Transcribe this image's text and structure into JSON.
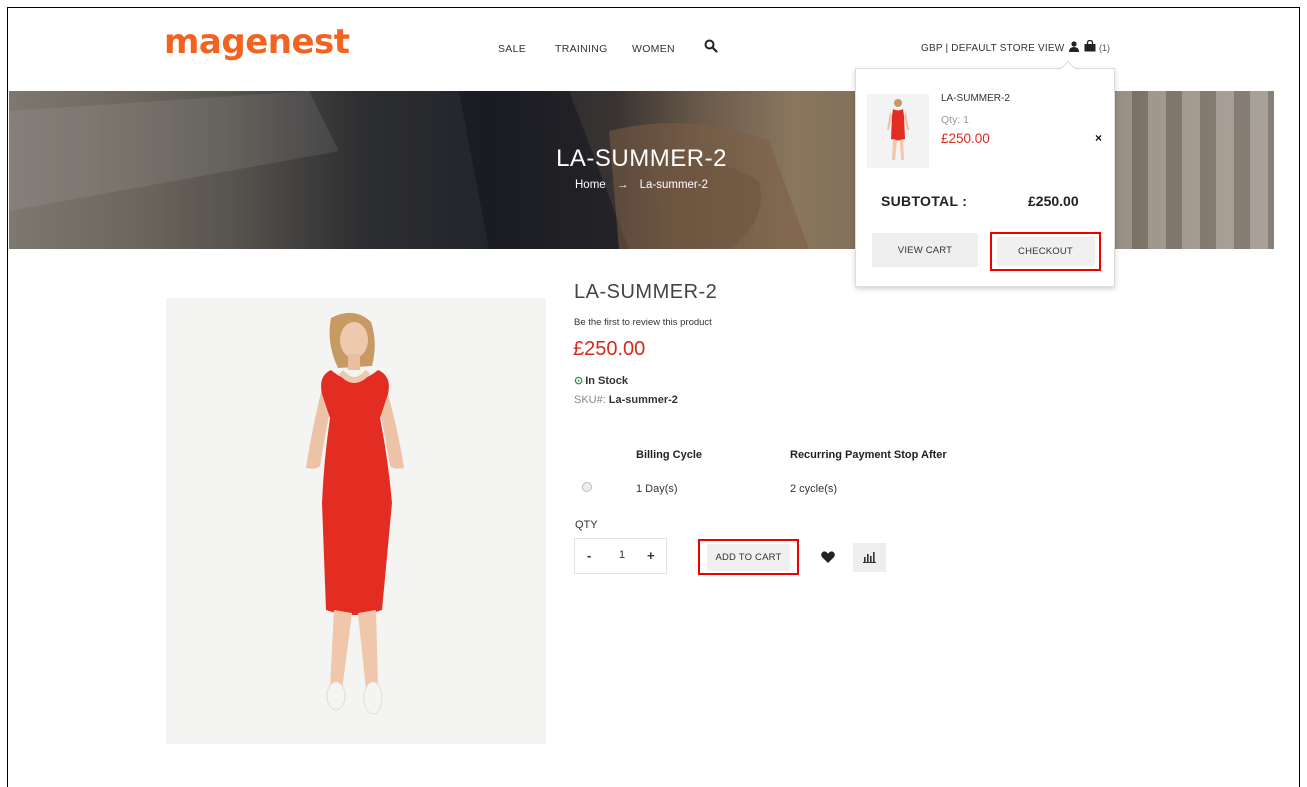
{
  "header": {
    "logo_part1": "mage",
    "logo_part2": "nest",
    "logo_color1": "#f26322",
    "logo_color2": "#f26322",
    "nav": [
      {
        "label": "SALE"
      },
      {
        "label": "TRAINING"
      },
      {
        "label": "WOMEN"
      }
    ],
    "store_label": "GBP | DEFAULT STORE VIEW",
    "cart_count": "(1)",
    "icons": [
      "search-icon",
      "user-icon",
      "cart-icon"
    ]
  },
  "banner": {
    "title": "LA-SUMMER-2",
    "breadcrumb_home": "Home",
    "breadcrumb_arrow": "→",
    "breadcrumb_current": "La-summer-2"
  },
  "product": {
    "title": "LA-SUMMER-2",
    "review_text": "Be the first to review this product",
    "price": "£250.00",
    "stock": "In Stock",
    "sku_label": "SKU#:",
    "sku_value": "La-summer-2",
    "billing_header": "Billing Cycle",
    "recurring_header": "Recurring Payment Stop After",
    "billing_value": "1 Day(s)",
    "recurring_value": "2 cycle(s)",
    "qty_label": "QTY",
    "qty_minus": "-",
    "qty_value": "1",
    "qty_plus": "+",
    "add_to_cart": "ADD TO CART",
    "price_color": "#d52b1e"
  },
  "minicart": {
    "item_name": "LA-SUMMER-2",
    "item_qty": "Qty: 1",
    "item_price": "£250.00",
    "remove": "×",
    "subtotal_label": "SUBTOTAL :",
    "subtotal_value": "£250.00",
    "view_cart": "VIEW CART",
    "checkout": "CHECKOUT",
    "highlight_color": "#ee0000"
  }
}
